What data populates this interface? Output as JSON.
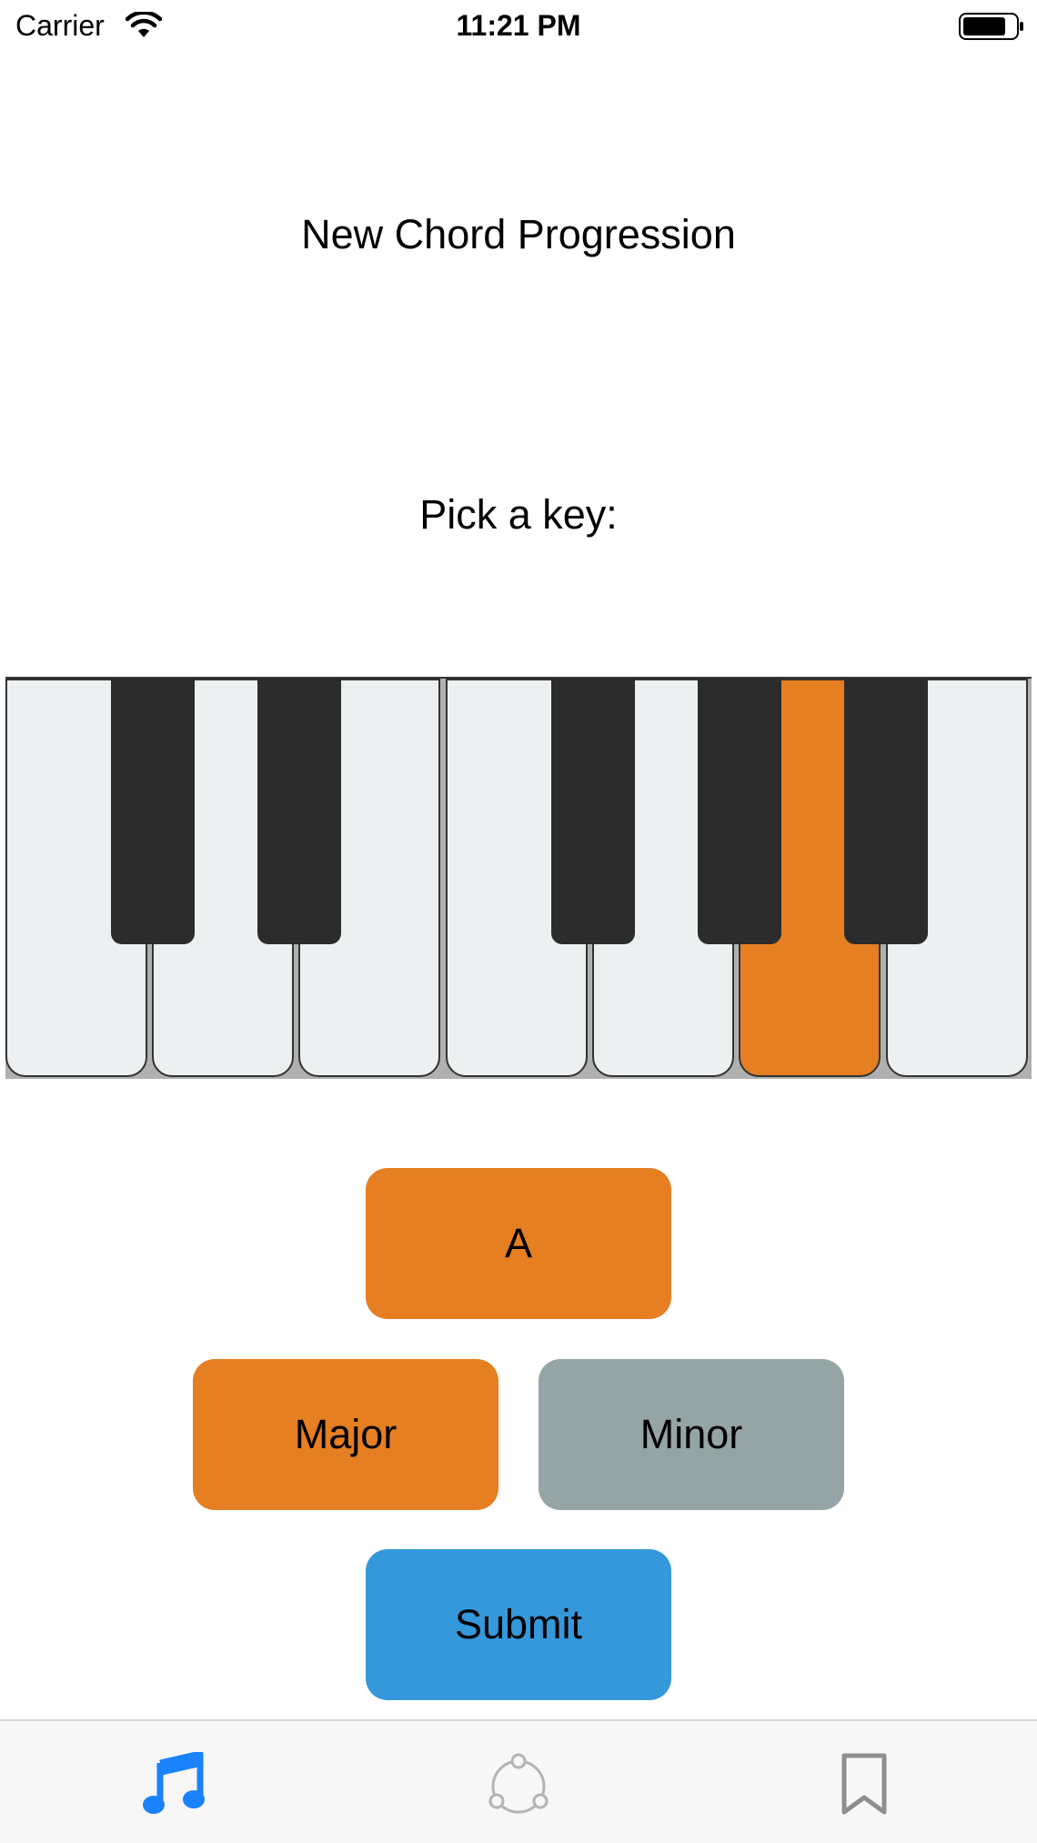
{
  "status_bar": {
    "carrier": "Carrier",
    "time": "11:21 PM",
    "wifi_icon": "wifi-icon",
    "battery_icon": "battery-icon"
  },
  "screen": {
    "title": "New Chord Progression",
    "prompt": "Pick a key:"
  },
  "piano": {
    "white_keys": 7,
    "black_keys": 5,
    "selected_key": "A",
    "colors": {
      "white": "#ecf0f1",
      "black": "#2c2c2c",
      "selected": "#e67e22"
    }
  },
  "buttons": {
    "key_label": "A",
    "major_label": "Major",
    "minor_label": "Minor",
    "submit_label": "Submit",
    "selected_mode": "Major",
    "colors": {
      "selected": "#e67e22",
      "unselected": "#95a5a6",
      "submit": "#3498db"
    }
  },
  "tab_bar": {
    "tabs": [
      {
        "icon": "music-note-icon",
        "active": true,
        "color": "#1a82fb"
      },
      {
        "icon": "share-cycle-icon",
        "active": false,
        "color": "#b4b4b4"
      },
      {
        "icon": "bookmark-icon",
        "active": false,
        "color": "#8e8e8e"
      }
    ]
  }
}
